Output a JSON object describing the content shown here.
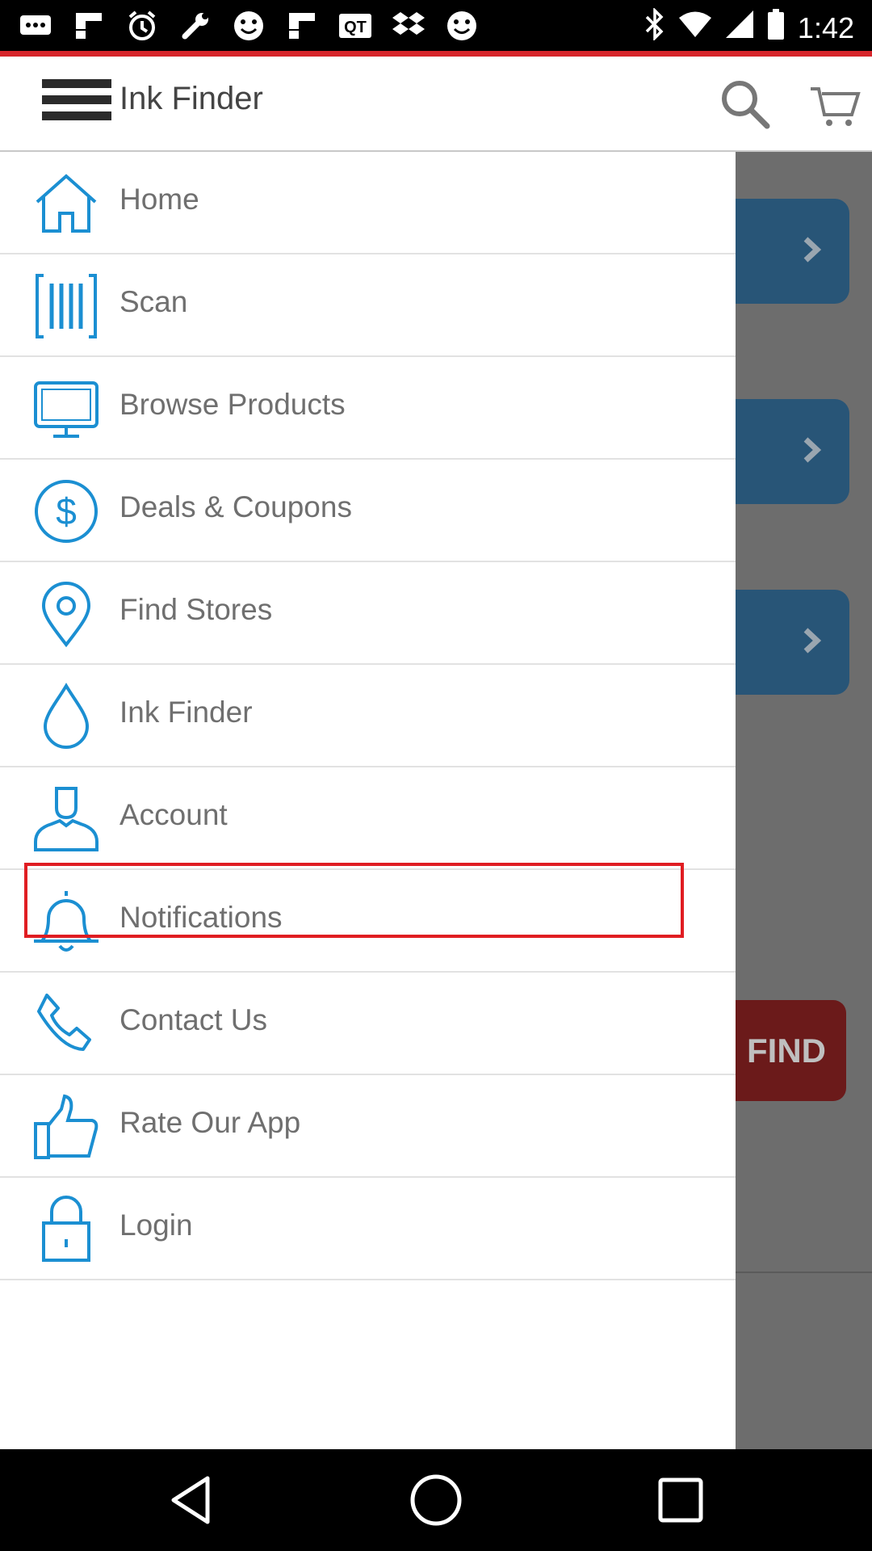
{
  "status_bar": {
    "time": "1:42",
    "notification_icons": [
      "chat-bubbles-icon",
      "flipboard-icon",
      "alarm-icon",
      "wrench-icon",
      "smiley-icon",
      "flipboard-icon",
      "qt-icon",
      "dropbox-icon",
      "smiley-icon"
    ],
    "system_icons": [
      "bluetooth-icon",
      "wifi-icon",
      "signal-icon",
      "battery-icon"
    ]
  },
  "app_bar": {
    "title": "Ink Finder",
    "icons": {
      "menu": "hamburger-icon",
      "search": "search-icon",
      "cart": "cart-icon"
    }
  },
  "background": {
    "find_label": "FIND"
  },
  "drawer": {
    "items": [
      {
        "label": "Home",
        "icon": "home-icon"
      },
      {
        "label": "Scan",
        "icon": "barcode-icon"
      },
      {
        "label": "Browse Products",
        "icon": "monitor-icon"
      },
      {
        "label": "Deals & Coupons",
        "icon": "dollar-icon"
      },
      {
        "label": "Find Stores",
        "icon": "location-pin-icon"
      },
      {
        "label": "Ink Finder",
        "icon": "ink-drop-icon"
      },
      {
        "label": "Account",
        "icon": "person-icon"
      },
      {
        "label": "Notifications",
        "icon": "bell-icon"
      },
      {
        "label": "Contact Us",
        "icon": "phone-icon"
      },
      {
        "label": "Rate Our App",
        "icon": "thumbs-up-icon"
      },
      {
        "label": "Login",
        "icon": "lock-icon"
      }
    ]
  },
  "colors": {
    "accent_blue": "#1b8fd2",
    "brand_red": "#d7252b",
    "highlight_red": "#e01d22",
    "label_gray": "#6f6f6f"
  },
  "nav_bar": {
    "icons": [
      "back-icon",
      "home-circle-icon",
      "recents-icon"
    ]
  }
}
